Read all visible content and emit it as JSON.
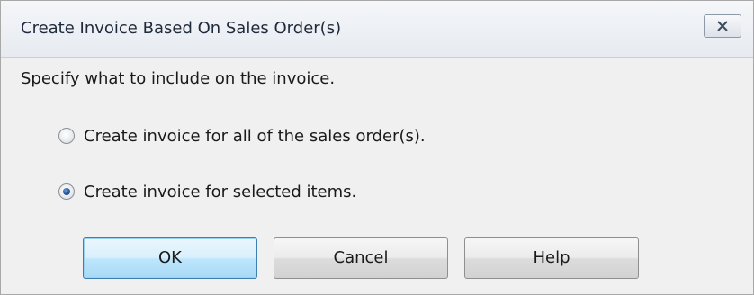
{
  "dialog": {
    "title": "Create Invoice Based On Sales Order(s)",
    "close_icon": "close-icon",
    "instruction": "Specify what to include on the invoice.",
    "options": [
      {
        "label": "Create invoice for all of the sales order(s).",
        "selected": false
      },
      {
        "label": "Create invoice for selected items.",
        "selected": true
      }
    ],
    "buttons": {
      "ok": "OK",
      "cancel": "Cancel",
      "help": "Help"
    }
  },
  "colors": {
    "default_button_border": "#3c7fb1",
    "radio_selected": "#1f4f99"
  }
}
